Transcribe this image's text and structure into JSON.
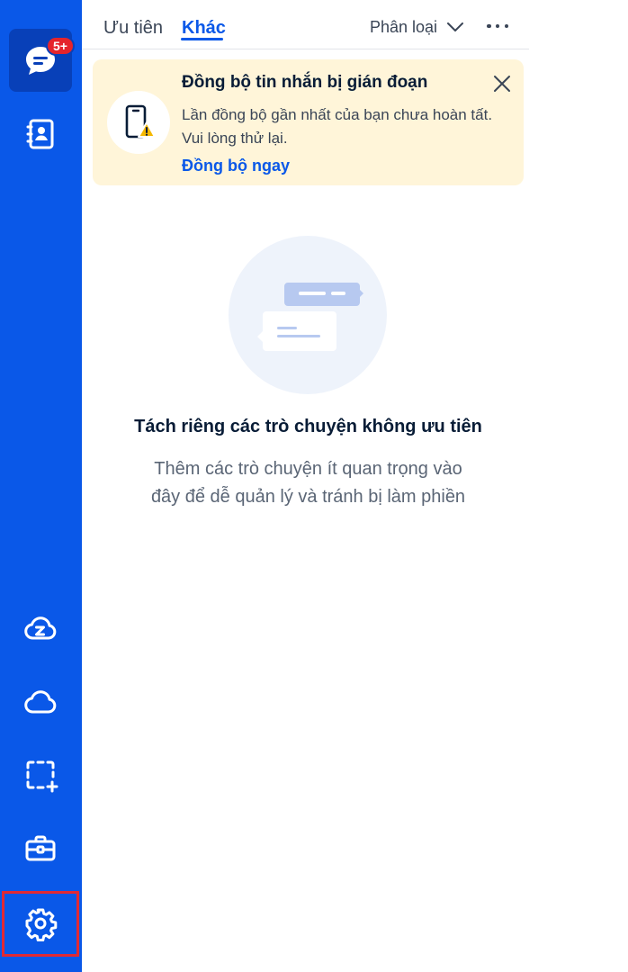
{
  "sidebar": {
    "badge": "5+",
    "items": [
      {
        "name": "messages",
        "icon": "chat-bubble-icon"
      },
      {
        "name": "contacts",
        "icon": "contact-book-icon"
      },
      {
        "name": "zcloud",
        "icon": "zcloud-icon"
      },
      {
        "name": "cloud",
        "icon": "cloud-icon"
      },
      {
        "name": "screenshot",
        "icon": "screenshot-capture-icon"
      },
      {
        "name": "toolbox",
        "icon": "briefcase-icon"
      },
      {
        "name": "settings",
        "icon": "gear-icon"
      }
    ],
    "highlight_color": "#e02934",
    "background": "#0a58e8"
  },
  "tabs": {
    "priority": "Ưu tiên",
    "other": "Khác",
    "classify": "Phân loại"
  },
  "banner": {
    "title": "Đồng bộ tin nhắn bị gián đoạn",
    "line1": "Lần đồng bộ gần nhất của bạn chưa hoàn tất.",
    "line2": "Vui lòng thử lại.",
    "action": "Đồng bộ ngay"
  },
  "empty_state": {
    "title": "Tách riêng các trò chuyện không ưu tiên",
    "desc_line1": "Thêm các trò chuyện ít quan trọng vào",
    "desc_line2": "đây để dễ quản lý và tránh bị làm phiền"
  },
  "colors": {
    "accent": "#0a58e8",
    "banner_bg": "#fff5d9",
    "badge": "#e5242b",
    "warning": "#f5b800"
  }
}
